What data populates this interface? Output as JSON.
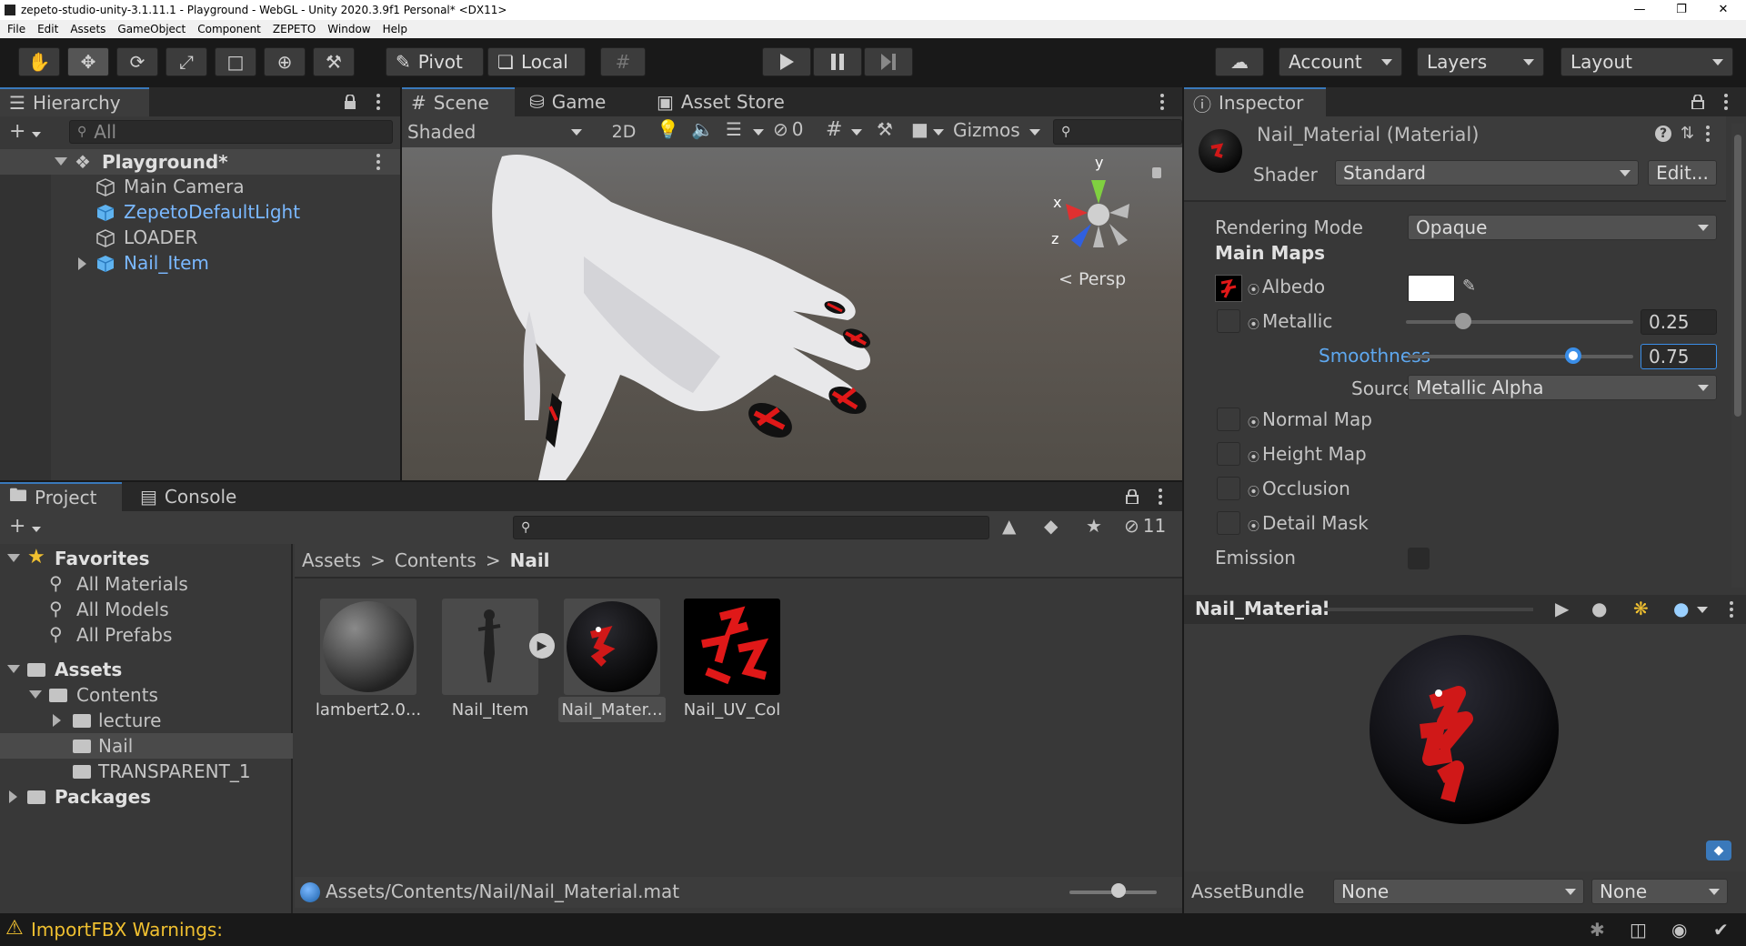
{
  "window": {
    "title": "zepeto-studio-unity-3.1.11.1 - Playground - WebGL - Unity 2020.3.9f1 Personal* <DX11>"
  },
  "menu": [
    "File",
    "Edit",
    "Assets",
    "GameObject",
    "Component",
    "ZEPETO",
    "Window",
    "Help"
  ],
  "toolbar": {
    "pivot": "Pivot",
    "local": "Local",
    "account": "Account",
    "layers": "Layers",
    "layout": "Layout"
  },
  "hierarchy": {
    "tab": "Hierarchy",
    "search_placeholder": "All",
    "scene": "Playground*",
    "items": [
      "Main Camera",
      "ZepetoDefaultLight",
      "LOADER",
      "Nail_Item"
    ]
  },
  "scene": {
    "tabs": [
      "Scene",
      "Game",
      "Asset Store"
    ],
    "shading": "Shaded",
    "mode2d": "2D",
    "hidden_count": "0",
    "gizmos": "Gizmos",
    "persp": "< Persp",
    "axes": {
      "x": "x",
      "y": "y",
      "z": "z"
    }
  },
  "project": {
    "tabs": [
      "Project",
      "Console"
    ],
    "hidden_count": "11",
    "favorites": "Favorites",
    "fav_items": [
      "All Materials",
      "All Models",
      "All Prefabs"
    ],
    "assets": "Assets",
    "contents": "Contents",
    "folders": [
      "lecture",
      "Nail",
      "TRANSPARENT_1"
    ],
    "packages": "Packages",
    "breadcrumb": [
      "Assets",
      "Contents",
      "Nail"
    ],
    "files": [
      "lambert2.0...",
      "Nail_Item",
      "Nail_Mater...",
      "Nail_UV_Col"
    ],
    "path": "Assets/Contents/Nail/Nail_Material.mat"
  },
  "inspector": {
    "tab": "Inspector",
    "name": "Nail_Material (Material)",
    "shader_label": "Shader",
    "shader": "Standard",
    "edit": "Edit...",
    "rendering_mode_label": "Rendering Mode",
    "rendering_mode": "Opaque",
    "main_maps": "Main Maps",
    "albedo": "Albedo",
    "metallic": "Metallic",
    "metallic_value": "0.25",
    "metallic_level": 0.25,
    "smoothness": "Smoothness",
    "smoothness_value": "0.75",
    "smoothness_level": 0.75,
    "source_label": "Source",
    "source": "Metallic Alpha",
    "normal_map": "Normal Map",
    "height_map": "Height Map",
    "occlusion": "Occlusion",
    "detail_mask": "Detail Mask",
    "emission": "Emission",
    "preview_title": "Nail_Material",
    "assetbundle_label": "AssetBundle",
    "assetbundle": "None",
    "assetbundle_variant": "None"
  },
  "status": {
    "message": "ImportFBX Warnings:"
  },
  "colors": {
    "accent": "#3a79bb",
    "nail_red": "#e01818",
    "link_blue": "#7ab8ff"
  }
}
